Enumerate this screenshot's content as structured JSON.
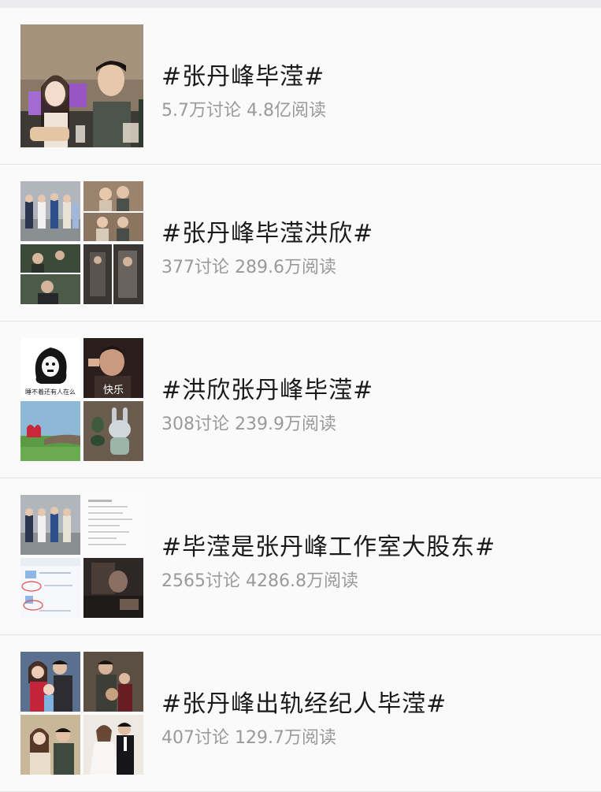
{
  "topics": [
    {
      "title": "#张丹峰毕滢#",
      "discussions": "5.7万讨论",
      "reads": "4.8亿阅读"
    },
    {
      "title": "#张丹峰毕滢洪欣#",
      "discussions": "377讨论",
      "reads": "289.6万阅读"
    },
    {
      "title": "#洪欣张丹峰毕滢#",
      "discussions": "308讨论",
      "reads": "239.9万阅读",
      "thumb_captions": [
        "睡不着还有人在么",
        "快乐"
      ]
    },
    {
      "title": "#毕滢是张丹峰工作室大股东#",
      "discussions": "2565讨论",
      "reads": "4286.8万阅读"
    },
    {
      "title": "#张丹峰出轨经纪人毕滢#",
      "discussions": "407讨论",
      "reads": "129.7万阅读"
    }
  ]
}
